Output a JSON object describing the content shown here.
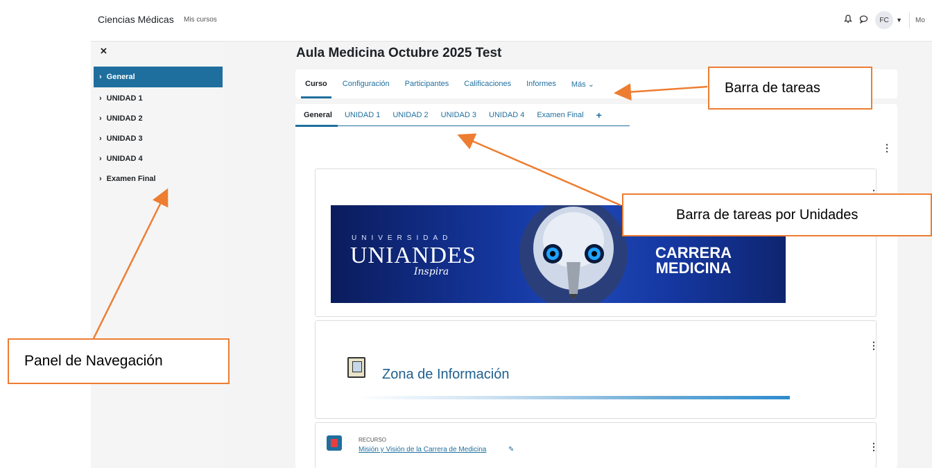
{
  "navbar": {
    "site_name": "Ciencias Médicas",
    "mis_cursos": "Mis cursos",
    "avatar_initials": "FC",
    "mode_label": "Mo"
  },
  "drawer": {
    "items": [
      {
        "label": "General"
      },
      {
        "label": "UNIDAD 1"
      },
      {
        "label": "UNIDAD 2"
      },
      {
        "label": "UNIDAD 3"
      },
      {
        "label": "UNIDAD 4"
      },
      {
        "label": "Examen Final"
      }
    ]
  },
  "course": {
    "title": "Aula Medicina Octubre 2025 Test"
  },
  "course_nav": {
    "items": [
      {
        "label": "Curso"
      },
      {
        "label": "Configuración"
      },
      {
        "label": "Participantes"
      },
      {
        "label": "Calificaciones"
      },
      {
        "label": "Informes"
      },
      {
        "label": "Más ⌄"
      }
    ]
  },
  "unit_tabs": {
    "items": [
      {
        "label": "General"
      },
      {
        "label": "UNIDAD 1"
      },
      {
        "label": "UNIDAD 2"
      },
      {
        "label": "UNIDAD 3"
      },
      {
        "label": "UNIDAD 4"
      },
      {
        "label": "Examen Final"
      }
    ],
    "add_symbol": "+"
  },
  "banner": {
    "universidad": "UNIVERSIDAD",
    "name": "UNIANDES",
    "tagline": "Inspira",
    "carrera_line1": "CARRERA",
    "carrera_line2": "MEDICINA"
  },
  "zona": {
    "title": "Zona de Información"
  },
  "resource": {
    "type_label": "RECURSO",
    "title": "Misión y Visión de la Carrera de Medicina"
  },
  "annotations": {
    "barra_tareas": "Barra de tareas",
    "barra_unidades": "Barra de tareas por Unidades",
    "panel_navegacion": "Panel de Navegación"
  },
  "colors": {
    "accent": "#1f6f9e",
    "callout_border": "#ed7d31",
    "banner_blue": "#1537a0"
  }
}
